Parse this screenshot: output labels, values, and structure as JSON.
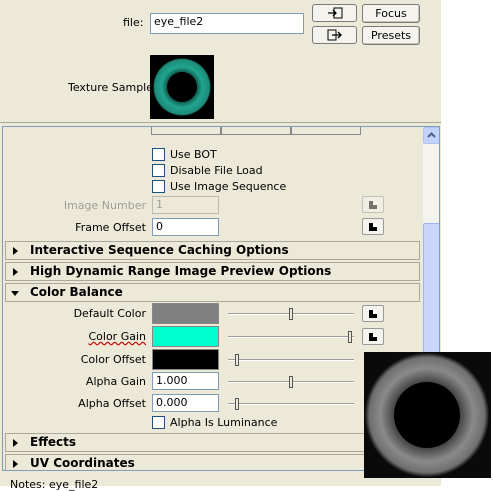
{
  "file": {
    "label": "file:",
    "value": "eye_file2",
    "focus_label": "Focus",
    "presets_label": "Presets",
    "load_icon": "import-icon",
    "export_icon": "export-icon"
  },
  "texture_sample_label": "Texture Sample",
  "options": {
    "use_bot": {
      "label": "Use BOT",
      "checked": false
    },
    "disable_file_load": {
      "label": "Disable File Load",
      "checked": false
    },
    "use_image_sequence": {
      "label": "Use Image Sequence",
      "checked": false
    },
    "image_number": {
      "label": "Image Number",
      "value": "1"
    },
    "frame_offset": {
      "label": "Frame Offset",
      "value": "0"
    }
  },
  "sections": {
    "interactive_caching": "Interactive Sequence Caching Options",
    "hdr_preview": "High Dynamic Range Image Preview Options",
    "color_balance": "Color Balance",
    "effects": "Effects",
    "uv_coordinates": "UV Coordinates"
  },
  "color_balance": {
    "default_color": {
      "label": "Default Color",
      "color": "#808080",
      "slider": 0.5
    },
    "color_gain": {
      "label": "Color Gain",
      "color": "#00ffcc",
      "slider": 1.0
    },
    "color_offset": {
      "label": "Color Offset",
      "color": "#000000",
      "slider": 0.0
    },
    "alpha_gain": {
      "label": "Alpha Gain",
      "value": "1.000",
      "slider": 0.5
    },
    "alpha_offset": {
      "label": "Alpha Offset",
      "value": "0.000",
      "slider": 0.0
    },
    "alpha_is_luminance": {
      "label": "Alpha Is Luminance",
      "checked": false
    }
  },
  "notes_label": "Notes:  eye_file2",
  "colors": {
    "panel_bg": "#ece9d8",
    "accent_teal": "#00ffcc",
    "underline_red": "#cc0000"
  }
}
